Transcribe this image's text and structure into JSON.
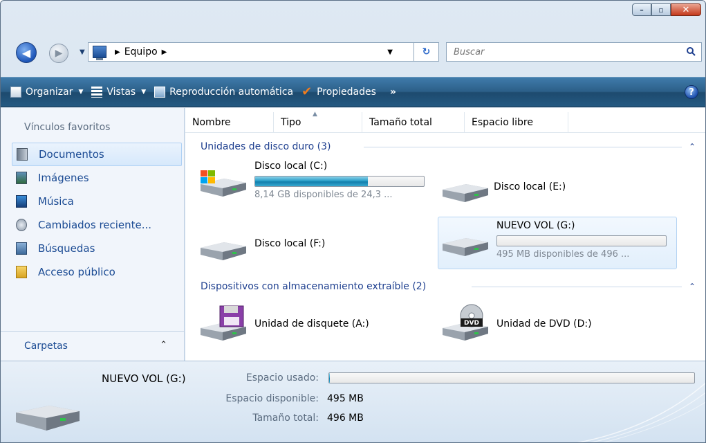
{
  "address": {
    "crumb": "Equipo",
    "search_placeholder": "Buscar"
  },
  "toolbar": {
    "organize": "Organizar",
    "views": "Vistas",
    "autoplay": "Reproducción automática",
    "properties": "Propiedades",
    "more": "»"
  },
  "nav": {
    "favorites_title": "Vínculos favoritos",
    "items": [
      {
        "label": "Documentos",
        "icon": "documents-icon"
      },
      {
        "label": "Imágenes",
        "icon": "pictures-icon"
      },
      {
        "label": "Música",
        "icon": "music-icon"
      },
      {
        "label": "Cambiados reciente...",
        "icon": "recent-icon"
      },
      {
        "label": "Búsquedas",
        "icon": "searches-icon"
      },
      {
        "label": "Acceso público",
        "icon": "public-folder-icon"
      }
    ],
    "folders_label": "Carpetas"
  },
  "columns": [
    "Nombre",
    "Tipo",
    "Tamaño total",
    "Espacio libre"
  ],
  "groups": {
    "hard_disks": "Unidades de disco duro (3)",
    "removable": "Dispositivos con almacenamiento extraíble (2)"
  },
  "drives": {
    "c": {
      "name": "Disco local (C:)",
      "free": "8,14 GB disponibles de 24,3 ...",
      "used_fraction": 0.67
    },
    "e": {
      "name": "Disco local (E:)"
    },
    "f": {
      "name": "Disco local (F:)"
    },
    "g": {
      "name": "NUEVO VOL (G:)",
      "free": "495 MB disponibles de 496 ...",
      "used_fraction": 0.002
    },
    "a": {
      "name": "Unidad de disquete (A:)"
    },
    "d": {
      "name": "Unidad de DVD (D:)"
    }
  },
  "details": {
    "name": "NUEVO VOL (G:)",
    "used_label": "Espacio usado:",
    "available_label": "Espacio disponible:",
    "available_value": "495 MB",
    "total_label": "Tamaño total:",
    "total_value": "496 MB",
    "used_fraction": 0.002
  },
  "colors": {
    "toolbar": "#2c5f88",
    "link": "#1a4a93",
    "bar_fill": "#2ba0c9"
  }
}
